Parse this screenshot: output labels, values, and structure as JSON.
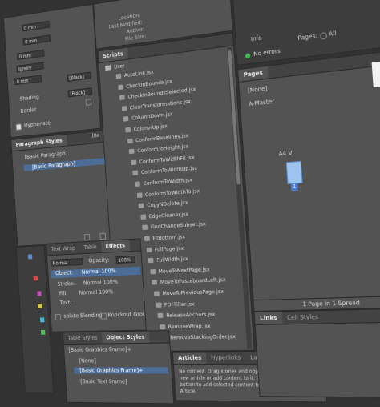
{
  "left": {
    "units": [
      "0 mm",
      "0 mm",
      "0 mm",
      "0 mm"
    ],
    "ignore": "Ignore",
    "shading_label": "Shading",
    "border_label": "Border",
    "swatch1": "[Black]",
    "swatch2": "[Black]",
    "hyphenate_label": "Hyphenate",
    "pstyles_title": "Paragraph Styles",
    "pstyles_tag": "[Ba",
    "pstyles_current": "[Basic Paragraph]",
    "pstyles_item": "[Basic Paragraph]"
  },
  "file_info": {
    "labels": [
      "Location:",
      "Last Modified:",
      "Author:",
      "File Size:"
    ]
  },
  "scripts": {
    "title": "Scripts",
    "folder": "User",
    "items": [
      "AutoLink.jsx",
      "CheckInBounds.jsx",
      "CheckInBoundsSelected.jsx",
      "ClearTransformations.jsx",
      "ColumnDown.jsx",
      "ColumnUp.jsx",
      "ConformBaselines.jsx",
      "ConformToHeight.jsx",
      "ConformToWidthFit.jsx",
      "ConformToWidthUp.jsx",
      "ConformToWidth.jsx",
      "ConformToWidthTo.jsx",
      "CopyNDelete.jsx",
      "EdgeCleaner.jsx",
      "FindChangeSubset.jsx",
      "FitBottom.jsx",
      "FullPage.jsx",
      "FullWidth.jsx",
      "MoveToNextPage.jsx",
      "MoveToPasteboardLeft.jsx",
      "MoveToPreviousPage.jsx",
      "PDFFilter.jsx",
      "ReleaseAnchors.jsx",
      "RemoveWrap.jsx",
      "RemoveStackingOrder.jsx"
    ]
  },
  "effects": {
    "tabs": [
      "Text Wrap",
      "Table",
      "Effects"
    ],
    "mode": "Normal",
    "opacity_label": "Opacity:",
    "opacity": "100%",
    "rows": [
      {
        "label": "Object:",
        "value": "Normal 100%"
      },
      {
        "label": "Stroke:",
        "value": "Normal 100%"
      },
      {
        "label": "Fill:",
        "value": "Normal 100%"
      },
      {
        "label": "Text:",
        "value": ""
      }
    ],
    "isolate": "Isolate Blending",
    "knockout": "Knockout Group"
  },
  "object_styles": {
    "tabs": [
      "Table Styles",
      "Object Styles"
    ],
    "current": "[Basic Graphics Frame]+",
    "items": [
      "[None]",
      "[Basic Graphics Frame]+",
      "[Basic Text Frame]"
    ]
  },
  "articles": {
    "tabs": [
      "Articles",
      "Hyperlinks",
      "Layers"
    ],
    "message": "No content. Drag stories and objects here to create a new article or add content to it. Or, Ctrl-click the Add button to add selected content to a new or selected Article."
  },
  "right": {
    "info_label": "Info",
    "preflight_status": "No errors",
    "pages_label": "Pages:",
    "pages_value": "All",
    "pages_title": "Pages",
    "none_master": "[None]",
    "a_master": "A-Master",
    "spread_label": "A4 V",
    "page_number": "1",
    "footer": "1 Page in 1 Spread",
    "bottom_tabs": [
      "Links",
      "Cell Styles"
    ]
  }
}
